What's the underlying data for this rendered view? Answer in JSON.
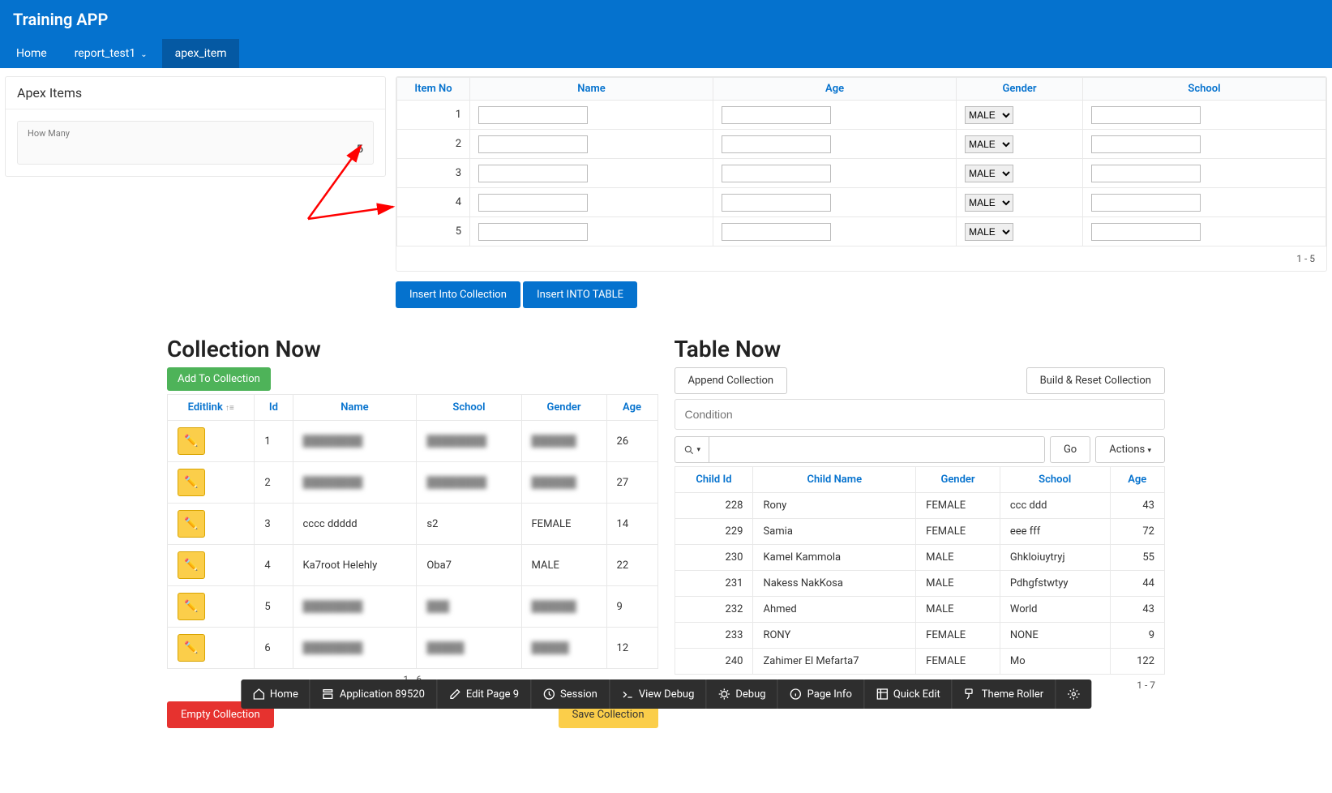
{
  "app_title": "Training APP",
  "user_label": "",
  "tabs": [
    {
      "label": "Home",
      "active": false,
      "chev": false
    },
    {
      "label": "report_test1",
      "active": false,
      "chev": true
    },
    {
      "label": "apex_item",
      "active": true,
      "chev": false
    }
  ],
  "apex_items": {
    "region_title": "Apex Items",
    "how_many_label": "How Many",
    "how_many_value": "5"
  },
  "items_grid": {
    "headers": [
      "Item No",
      "Name",
      "Age",
      "Gender",
      "School"
    ],
    "rows": [
      {
        "no": "1",
        "name": "",
        "age": "",
        "gender": "MALE",
        "school": ""
      },
      {
        "no": "2",
        "name": "",
        "age": "",
        "gender": "MALE",
        "school": ""
      },
      {
        "no": "3",
        "name": "",
        "age": "",
        "gender": "MALE",
        "school": ""
      },
      {
        "no": "4",
        "name": "",
        "age": "",
        "gender": "MALE",
        "school": ""
      },
      {
        "no": "5",
        "name": "",
        "age": "",
        "gender": "MALE",
        "school": ""
      }
    ],
    "range": "1 - 5",
    "insert_collection_label": "Insert Into Collection",
    "insert_table_label": "Insert INTO TABLE"
  },
  "collection_now": {
    "title": "Collection Now",
    "add_btn": "Add To Collection",
    "headers": [
      "Editlink",
      "Id",
      "Name",
      "School",
      "Gender",
      "Age"
    ],
    "rows": [
      {
        "id": "1",
        "name": "████████",
        "school": "████████",
        "gender": "██████",
        "age": "26",
        "blur": true
      },
      {
        "id": "2",
        "name": "████████",
        "school": "████████",
        "gender": "██████",
        "age": "27",
        "blur": true
      },
      {
        "id": "3",
        "name": "cccc ddddd",
        "school": "s2",
        "gender": "FEMALE",
        "age": "14",
        "blur": false
      },
      {
        "id": "4",
        "name": "Ka7root Helehly",
        "school": "Oba7",
        "gender": "MALE",
        "age": "22",
        "blur": false
      },
      {
        "id": "5",
        "name": "████████",
        "school": "███",
        "gender": "██████",
        "age": "9",
        "blur": true
      },
      {
        "id": "6",
        "name": "████████",
        "school": "█████",
        "gender": "█████",
        "age": "12",
        "blur": true
      }
    ],
    "range": "1 - 6",
    "empty_btn": "Empty Collection",
    "save_btn": "Save Collection"
  },
  "table_now": {
    "title": "Table Now",
    "append_btn": "Append Collection",
    "build_btn": "Build & Reset Collection",
    "condition_placeholder": "Condition",
    "go_label": "Go",
    "actions_label": "Actions",
    "headers": [
      "Child Id",
      "Child Name",
      "Gender",
      "School",
      "Age"
    ],
    "rows": [
      {
        "id": "228",
        "name": "Rony",
        "gender": "FEMALE",
        "school": "ccc ddd",
        "age": "43"
      },
      {
        "id": "229",
        "name": "Samia",
        "gender": "FEMALE",
        "school": "eee fff",
        "age": "72"
      },
      {
        "id": "230",
        "name": "Kamel Kammola",
        "gender": "MALE",
        "school": "Ghkloiuytryj",
        "age": "55"
      },
      {
        "id": "231",
        "name": "Nakess NakKosa",
        "gender": "MALE",
        "school": "Pdhgfstwtyy",
        "age": "44"
      },
      {
        "id": "232",
        "name": "Ahmed",
        "gender": "MALE",
        "school": "World",
        "age": "43"
      },
      {
        "id": "233",
        "name": "RONY",
        "gender": "FEMALE",
        "school": "NONE",
        "age": "9"
      },
      {
        "id": "240",
        "name": "Zahimer El Mefarta7",
        "gender": "FEMALE",
        "school": "Mo",
        "age": "122"
      }
    ],
    "range": "1 - 7"
  },
  "devbar": {
    "home": "Home",
    "app": "Application 89520",
    "edit": "Edit Page 9",
    "session": "Session",
    "viewdebug": "View Debug",
    "debug": "Debug",
    "pageinfo": "Page Info",
    "quickedit": "Quick Edit",
    "themeroller": "Theme Roller"
  }
}
